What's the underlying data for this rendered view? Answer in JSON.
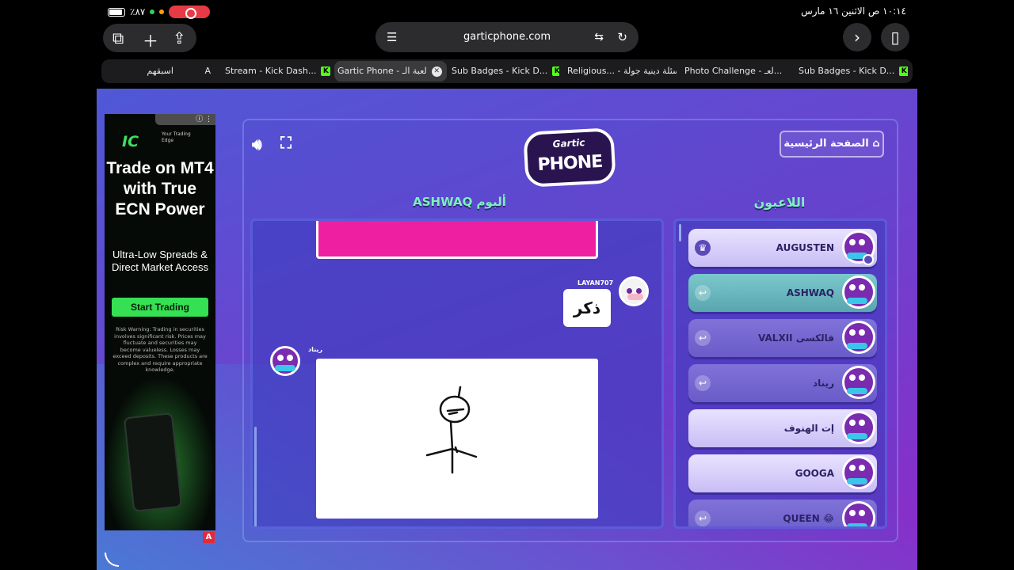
{
  "status": {
    "time": "١٠:١٤ ص  الاثنين ١٦ مارس",
    "battery": "٪٨٧"
  },
  "toolbar": {
    "url": "garticphone.com"
  },
  "tabs": [
    {
      "label": "اسبقهم",
      "extra": "A"
    },
    {
      "label": "Stream - Kick Dash...",
      "badge": "K"
    },
    {
      "label": "Gartic Phone - لعبة الـ",
      "close": "✕"
    },
    {
      "label": "Sub Badges - Kick D...",
      "badge": "K"
    },
    {
      "label": "Religious... - أسئلة دينية جولة"
    },
    {
      "label": "Photo Challenge - لعـ..."
    },
    {
      "label": "Sub Badges - Kick D...",
      "badge": "K"
    }
  ],
  "ad": {
    "brand": "IC",
    "tagline": "Your Trading Edge",
    "headline": "Trade on MT4 with True ECN Power",
    "sub": "Ultra-Low Spreads & Direct Market Access",
    "cta": "Start Trading",
    "risk": "Risk Warning: Trading in securities involves significant risk. Prices may fluctuate and securities may become valueless. Losses may exceed deposits. These products are complex and require appropriate knowledge.",
    "choice": "A"
  },
  "game": {
    "logo_top": "Gartic",
    "logo_main": "PHONE",
    "home": "الصفحة الرئيسية",
    "album_title": "ألبوم ASHWAQ",
    "players_title": "اللاعبون",
    "messages": [
      {
        "user": "LAYAN707",
        "text": "ذكر"
      },
      {
        "user": "ريناد"
      }
    ],
    "players": [
      {
        "name": "AUGUSTEN"
      },
      {
        "name": "ASHWAQ"
      },
      {
        "name": "VALXII فالكسى"
      },
      {
        "name": "ريناد"
      },
      {
        "name": "إت الهنوف"
      },
      {
        "name": "GOOGA"
      },
      {
        "name": "QUEEN 😂"
      }
    ]
  }
}
